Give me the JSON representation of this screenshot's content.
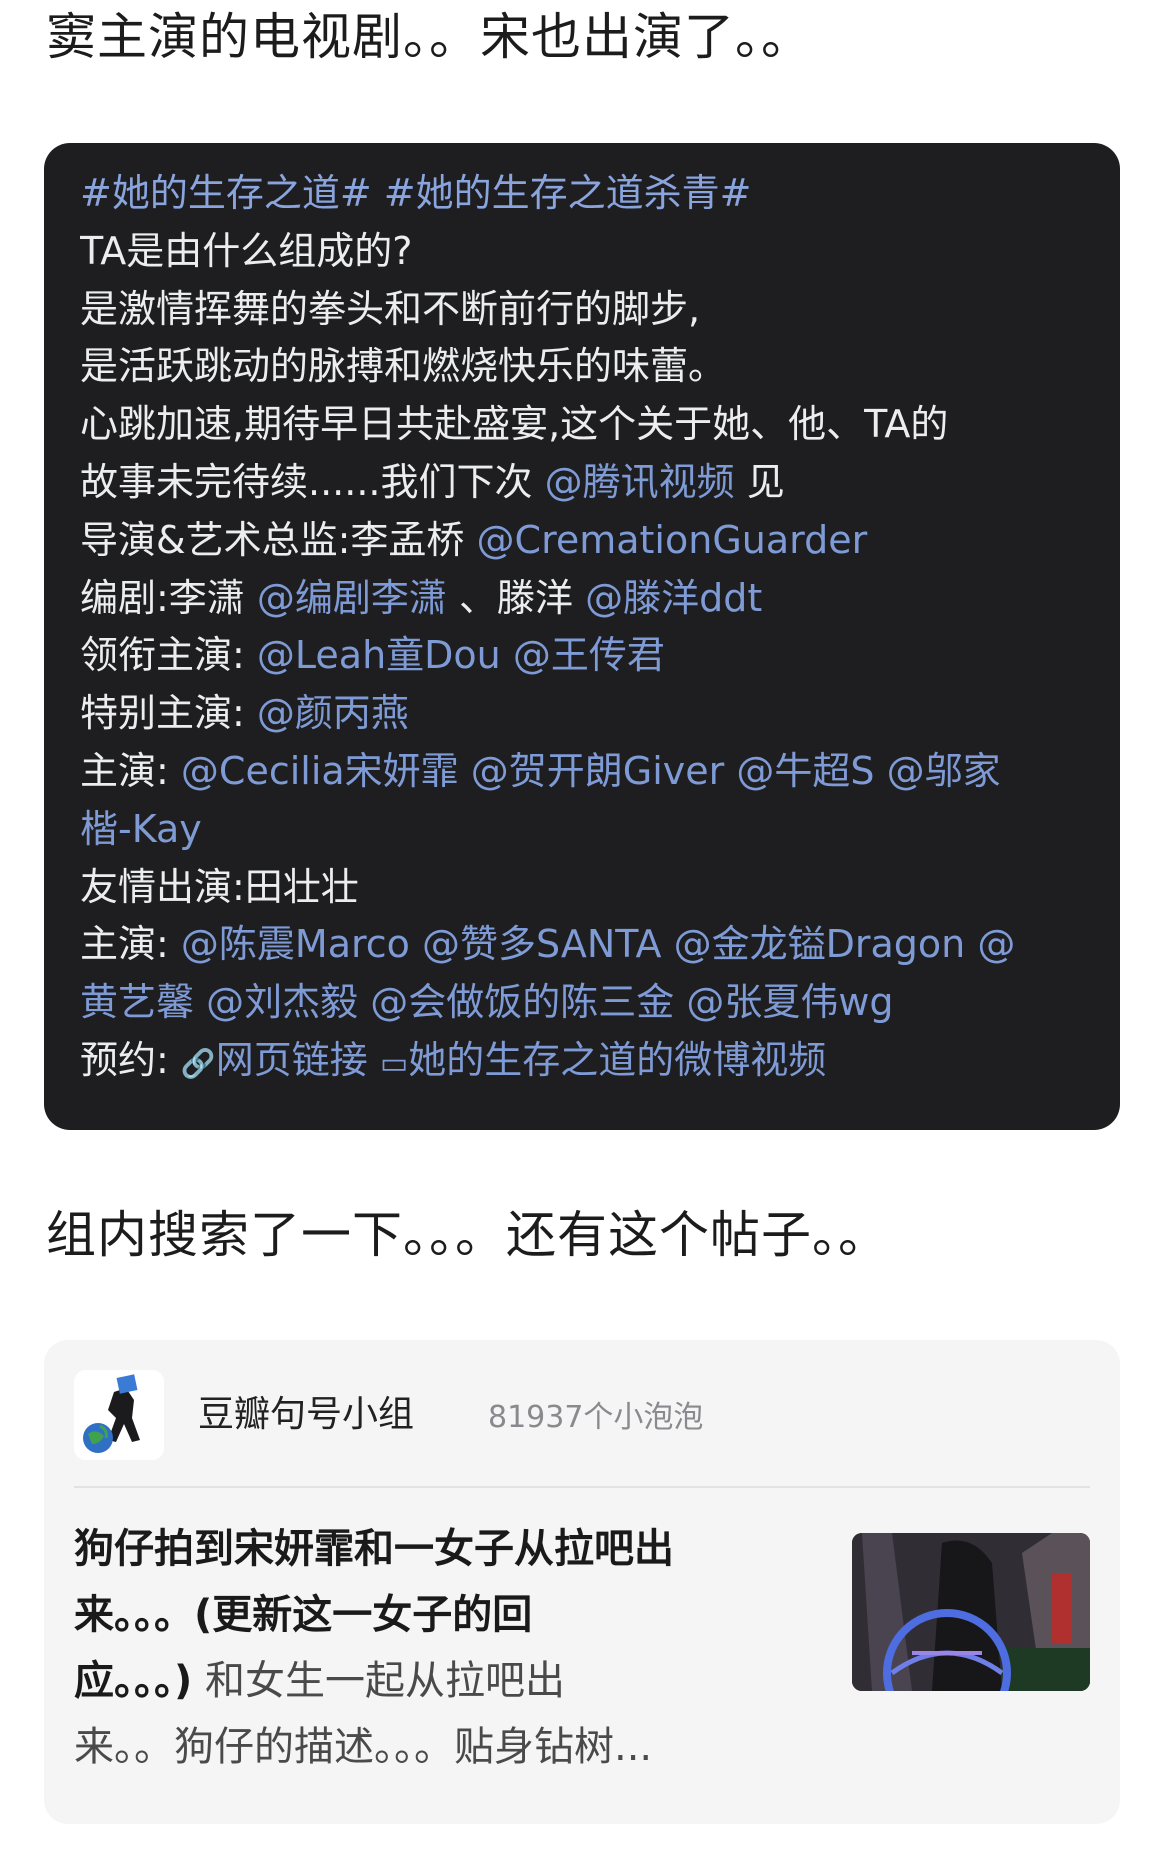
{
  "caption_top": "窦主演的电视剧。。宋也出演了。。",
  "post": {
    "hashtag_1": "#她的生存之道#",
    "hashtag_2": "#她的生存之道杀青#",
    "line_1": "TA是由什么组成的?",
    "line_2": "是激情挥舞的拳头和不断前行的脚步,",
    "line_3": "是活跃跳动的脉搏和燃烧快乐的味蕾。",
    "line_4": "心跳加速,期待早日共赴盛宴,这个关于她、他、TA的",
    "line_5_text": "故事未完待续......我们下次",
    "mention_tencent": "@腾讯视频",
    "line_5_end": "见",
    "director_label": "导演&艺术总监:李孟桥",
    "mention_director": "@CremationGuarder",
    "writer_label": "编剧:李潇",
    "mention_writer_1": "@编剧李潇",
    "writer_sep": "、滕洋",
    "mention_writer_2": "@滕洋ddt",
    "lead_label": "领衔主演:",
    "mention_lead_1": "@Leah童Dou",
    "mention_lead_2": "@王传君",
    "special_label": "特别主演:",
    "mention_special": "@颜丙燕",
    "cast_label": "主演:",
    "mention_cast_1": "@Cecilia宋妍霏",
    "mention_cast_2": "@贺开朗Giver",
    "mention_cast_3": "@牛超S",
    "mention_cast_4a": "@邬家",
    "mention_cast_4b": "楷-Kay",
    "friend_label": "友情出演:田壮壮",
    "cast2_label": "主演:",
    "mention_cast2_1": "@陈震Marco",
    "mention_cast2_2": "@赞多SANTA",
    "mention_cast2_3": "@金龙镒Dragon",
    "mention_cast2_4a": "@",
    "mention_cast2_4b": "黄艺馨",
    "mention_cast2_5": "@刘杰毅",
    "mention_cast2_6": "@会做饭的陈三金",
    "mention_cast2_7": "@张夏伟wg",
    "reserve_label": "预约:",
    "link_web_icon": "🔗",
    "link_web": "网页链接",
    "link_video_icon": "▭",
    "link_video": "她的生存之道的微博视频"
  },
  "caption_mid": "组内搜索了一下。。。还有这个帖子。。",
  "share": {
    "group_name": "豆瓣句号小组",
    "members": "81937个小泡泡",
    "title_line_1": "狗仔拍到宋妍霏和一女子从拉吧出",
    "title_line_2": "来。。。(更新这一女子的回",
    "title_line_3": "应。。。)",
    "excerpt_line_3": "和女生一起从拉吧出",
    "excerpt_line_4": "来。。狗仔的描述。。。贴身钻树..."
  },
  "colors": {
    "card_bg": "#1e1e20",
    "card_text": "#ecedf0",
    "link": "#7f9bd6",
    "share_bg": "#f5f5f6",
    "muted": "#8a8a8e"
  }
}
